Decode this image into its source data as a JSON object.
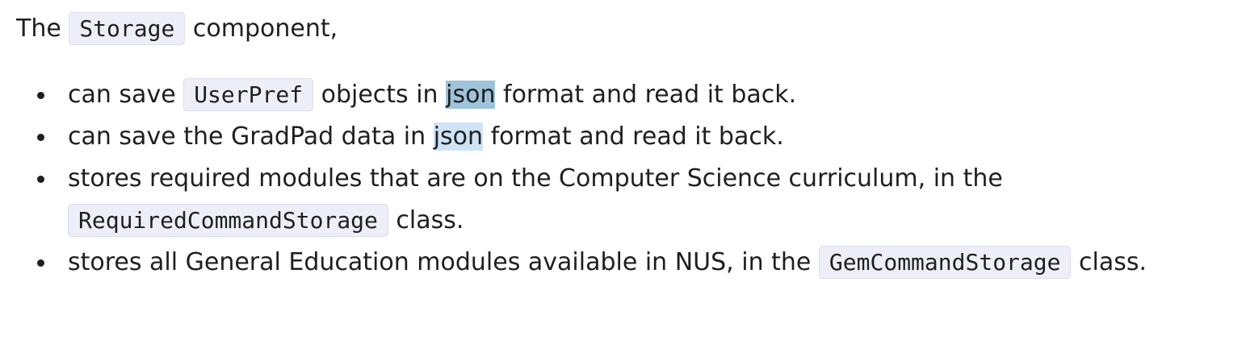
{
  "intro": {
    "before": "The",
    "code": "Storage",
    "after": "component,"
  },
  "items": [
    {
      "t1": "can save",
      "code": "UserPref",
      "t2": "objects in",
      "highlight": "json",
      "t3": "format and read it back."
    },
    {
      "t1": "can save the GradPad data in",
      "highlight": "json",
      "t2": "format and read it back."
    },
    {
      "t1": "stores required modules that are on the Computer Science curriculum, in the",
      "code": "RequiredCommandStorage",
      "t2": "class."
    },
    {
      "t1": "stores all General Education modules available in NUS, in the",
      "code": "GemCommandStorage",
      "t2": "class."
    }
  ]
}
